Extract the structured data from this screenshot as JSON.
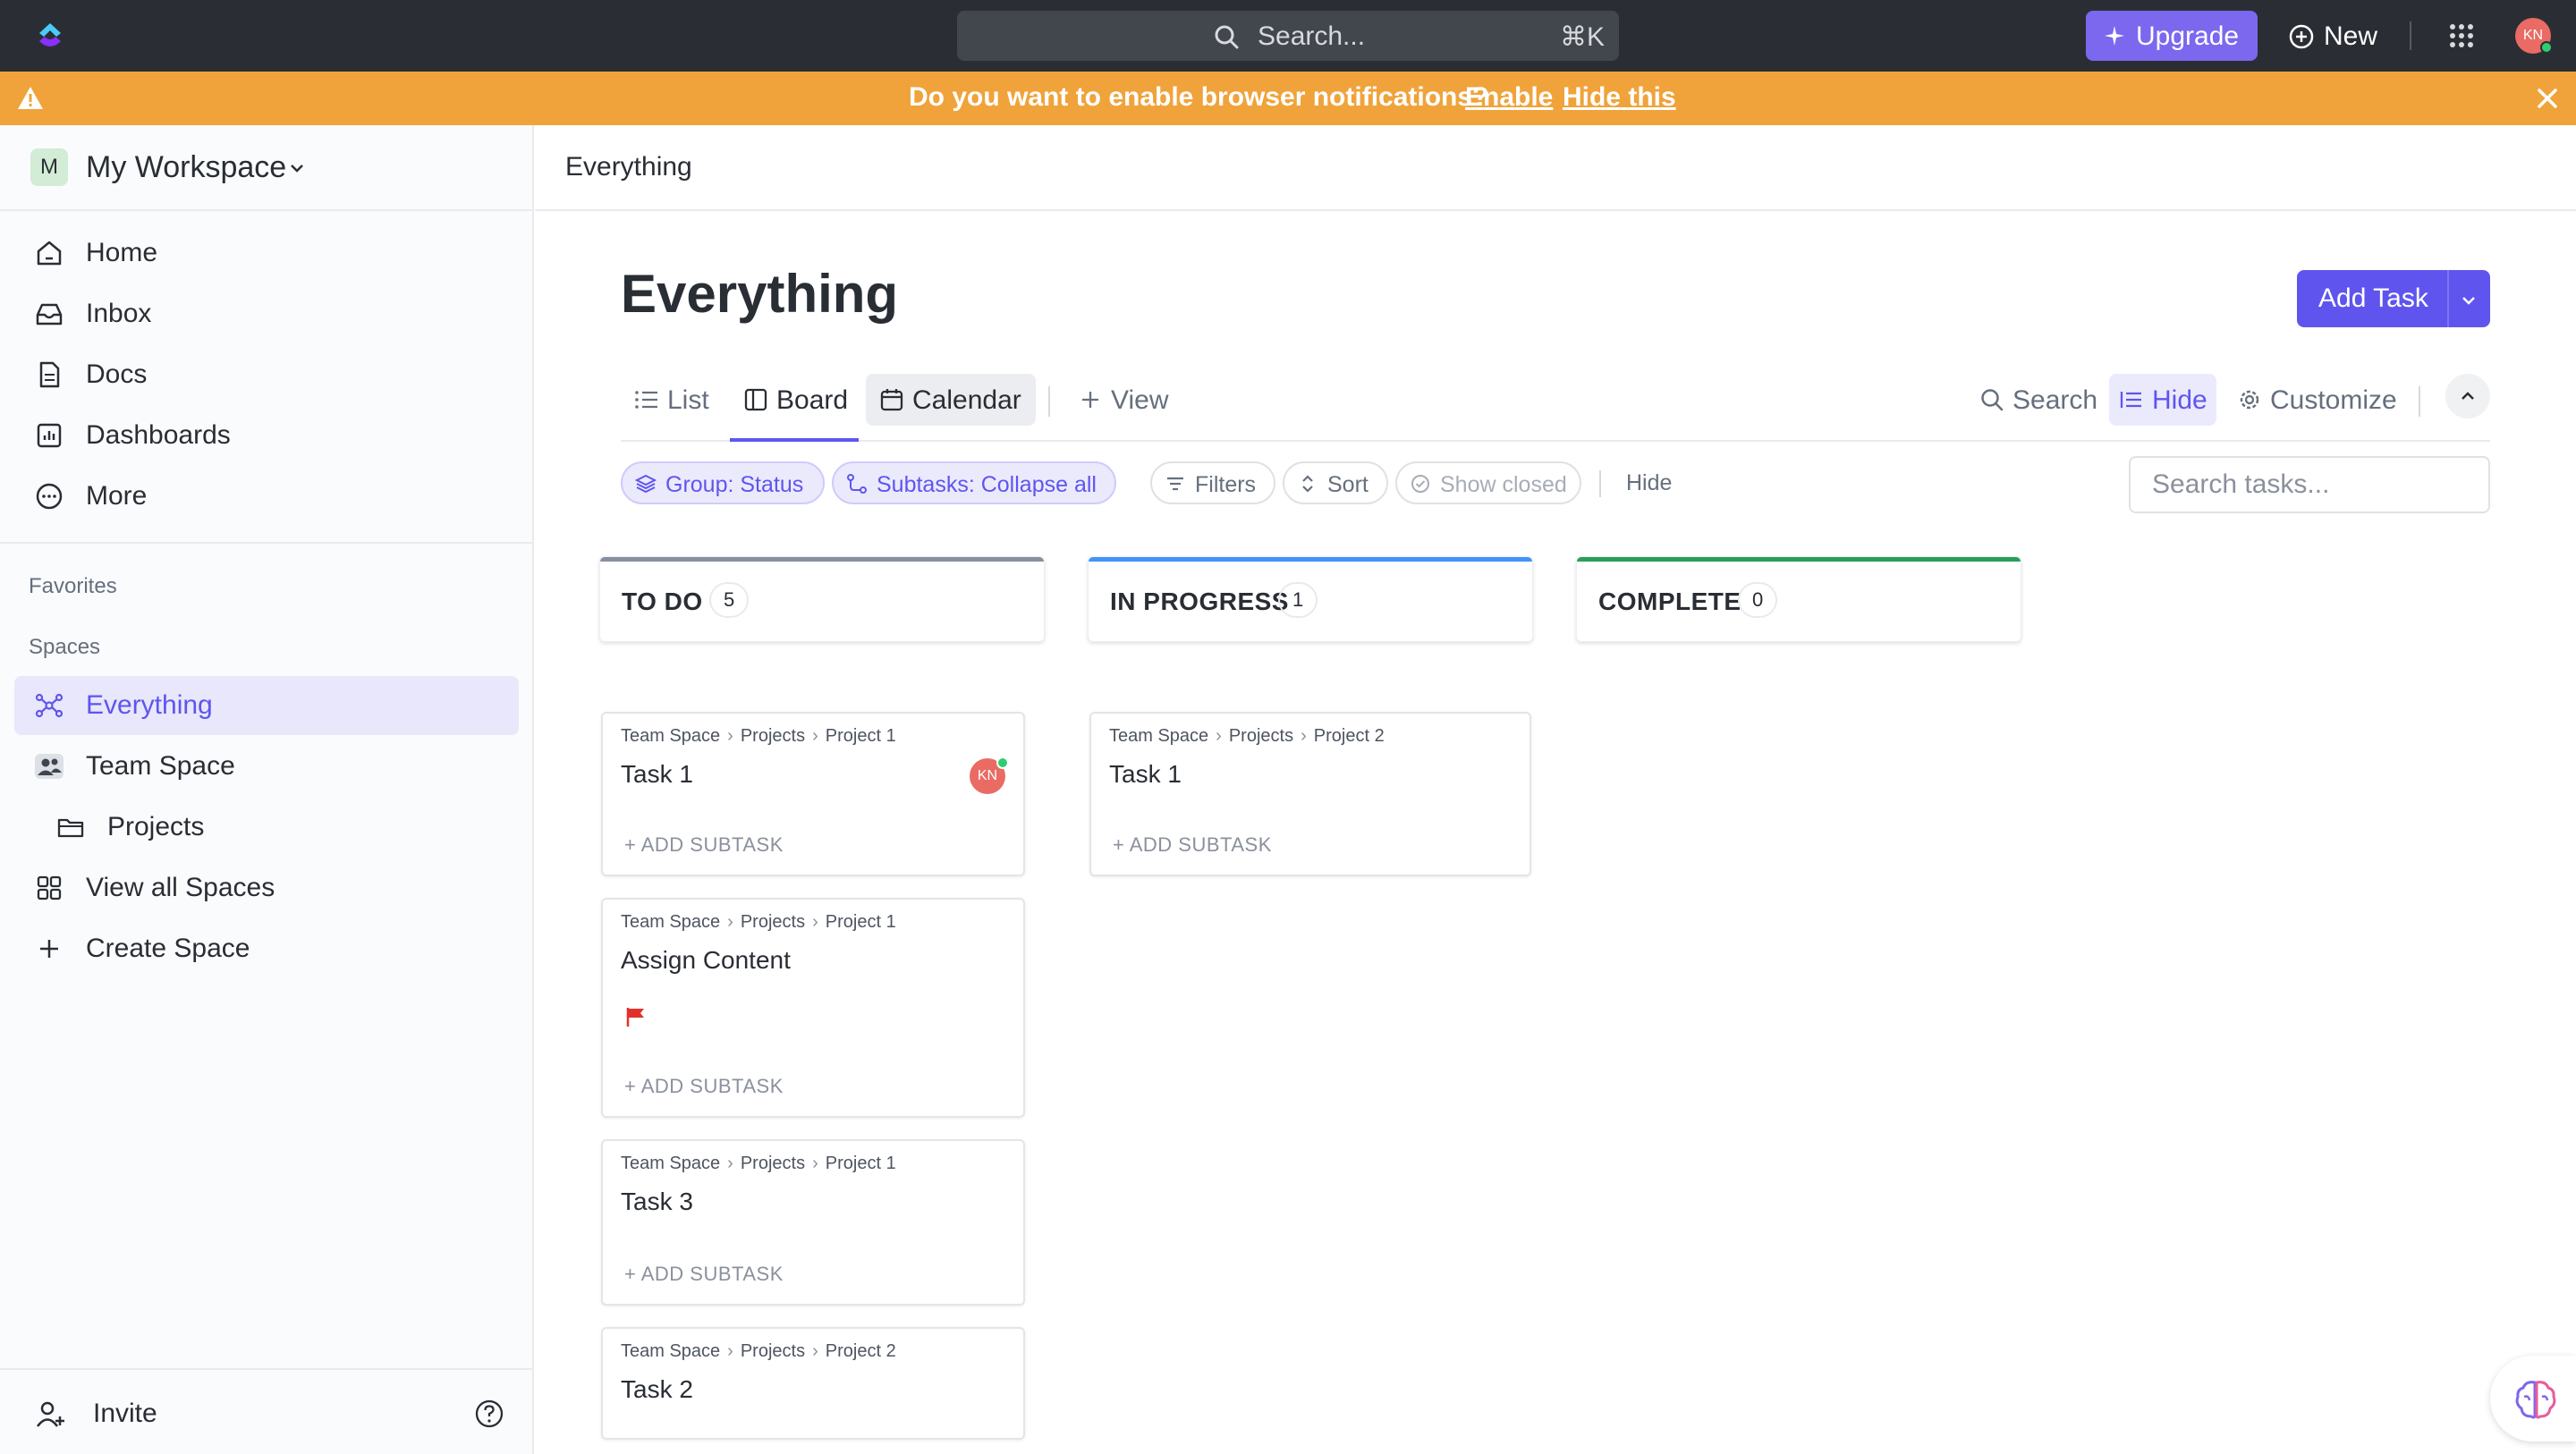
{
  "topbar": {
    "search_label": "Search...",
    "search_shortcut": "⌘K",
    "upgrade_label": "Upgrade",
    "new_label": "New",
    "avatar_initials": "KN"
  },
  "notification": {
    "message": "Do you want to enable browser notifications?",
    "enable_label": "Enable",
    "hide_label": "Hide this"
  },
  "sidebar": {
    "workspace_initial": "M",
    "workspace_name": "My Workspace",
    "nav": [
      "Home",
      "Inbox",
      "Docs",
      "Dashboards",
      "More"
    ],
    "favorites_label": "Favorites",
    "spaces_label": "Spaces",
    "spaces": [
      "Everything",
      "Team Space",
      "Projects",
      "View all Spaces",
      "Create Space"
    ],
    "invite_label": "Invite"
  },
  "main": {
    "breadcrumb": "Everything",
    "title": "Everything",
    "add_task_label": "Add Task",
    "tabs": [
      "List",
      "Board",
      "Calendar",
      "View"
    ],
    "right_controls": [
      "Search",
      "Hide",
      "Customize"
    ],
    "toolbar": {
      "group": "Group: Status",
      "subtasks": "Subtasks: Collapse all",
      "filters": "Filters",
      "sort": "Sort",
      "show_closed": "Show closed",
      "hide": "Hide",
      "search_placeholder": "Search tasks..."
    }
  },
  "board": {
    "add_subtask_label": "+ ADD SUBTASK",
    "columns": [
      {
        "title": "TO DO",
        "count": "5",
        "color": "#87909e"
      },
      {
        "title": "IN PROGRESS",
        "count": "1",
        "color": "#4194f6"
      },
      {
        "title": "COMPLETE",
        "count": "0",
        "color": "#2a9d5a"
      }
    ],
    "cards": [
      {
        "path": [
          "Team Space",
          "Projects",
          "Project 1"
        ],
        "name": "Task 1",
        "assignee": "KN"
      },
      {
        "path": [
          "Team Space",
          "Projects",
          "Project 1"
        ],
        "name": "Assign Content",
        "flag_color": "#e2312d"
      },
      {
        "path": [
          "Team Space",
          "Projects",
          "Project 1"
        ],
        "name": "Task 3"
      },
      {
        "path": [
          "Team Space",
          "Projects",
          "Project 2"
        ],
        "name": "Task 2"
      },
      {
        "path": [
          "Team Space",
          "Projects",
          "Project 2"
        ],
        "name": "Task 1"
      }
    ]
  },
  "colors": {
    "accent": "#5f55ee",
    "upgrade": "#7b68ee",
    "notification_bg": "#f0a33a",
    "topbar_bg": "#2a2e34"
  }
}
